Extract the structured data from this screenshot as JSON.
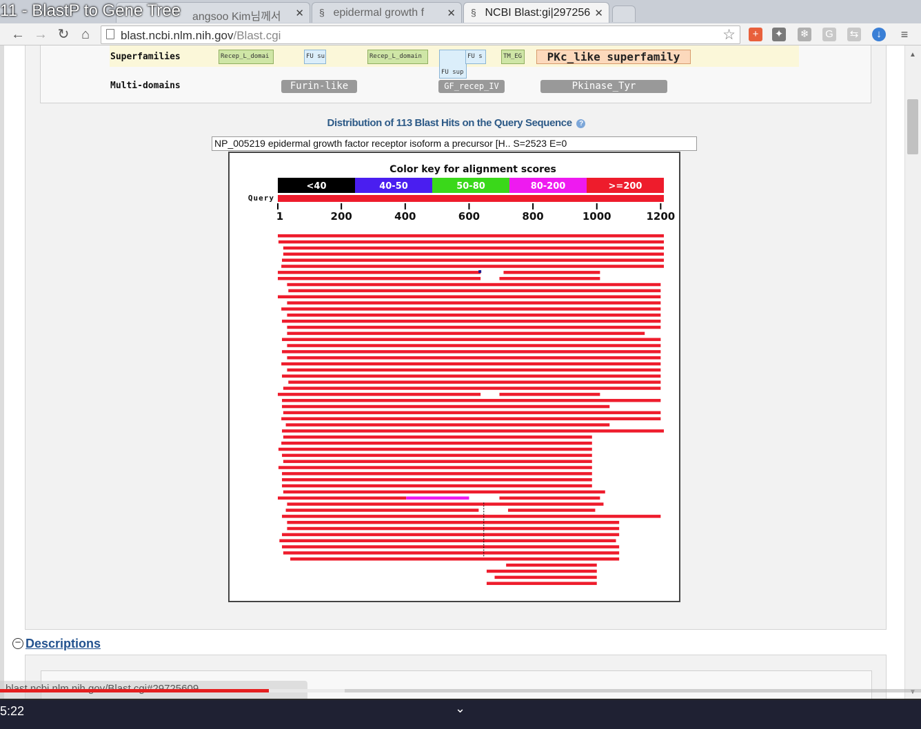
{
  "video": {
    "title": "11 - BlastP to Gene Tree",
    "time": "5:22",
    "progress": 0.292,
    "buffered": 0.374
  },
  "browser": {
    "tabs": [
      {
        "label": "angsoo Kim님께서",
        "icon": "page-icon"
      },
      {
        "label": "epidermal growth f",
        "icon": "ncbi-helix-icon"
      },
      {
        "label": "NCBI Blast:gi|297256",
        "icon": "ncbi-helix-icon",
        "active": true
      }
    ],
    "url_host": "blast.ncbi.nlm.nih.gov",
    "url_path": "/Blast.cgi",
    "status_url": "blast.ncbi.nlm.nih.gov/Blast.cgi#29725609"
  },
  "domains": {
    "superfamilies_label": "Superfamilies",
    "multi_label": "Multi-domains",
    "superfamilies": [
      {
        "label": "Recep_L_domai",
        "color": "green"
      },
      {
        "label": "FU su",
        "color": "blue"
      },
      {
        "label": "Recep_L_domain",
        "color": "green"
      },
      {
        "label": "FU sup",
        "color": "blue"
      },
      {
        "label": "FU s",
        "color": "blue"
      },
      {
        "label": "TM_EG",
        "color": "green"
      },
      {
        "label": "PKc_like superfamily",
        "color": "orange"
      }
    ],
    "multi": [
      "Furin-like",
      "GF_recep_IV",
      "Pkinase_Tyr"
    ]
  },
  "distribution": {
    "title": "Distribution of 113 Blast Hits on the Query Sequence",
    "selected_hit": "NP_005219 epidermal growth factor receptor isoform a precursor [H.. S=2523 E=0",
    "key_title": "Color key for alignment scores",
    "key": [
      {
        "label": "<40",
        "color": "#000000"
      },
      {
        "label": "40-50",
        "color": "#4a1ef0"
      },
      {
        "label": "50-80",
        "color": "#3ad81a"
      },
      {
        "label": "80-200",
        "color": "#ee1af0"
      },
      {
        "label": ">=200",
        "color": "#ee1c2c"
      }
    ],
    "query_label": "Query",
    "axis_ticks": [
      "1",
      "200",
      "400",
      "600",
      "800",
      "1000",
      "1200"
    ],
    "query_length": 1210
  },
  "descriptions_label": "Descriptions",
  "colors": {
    "hit_red": "#ee1c2c",
    "title_blue": "#2d5a87",
    "link_blue": "#23528f"
  }
}
